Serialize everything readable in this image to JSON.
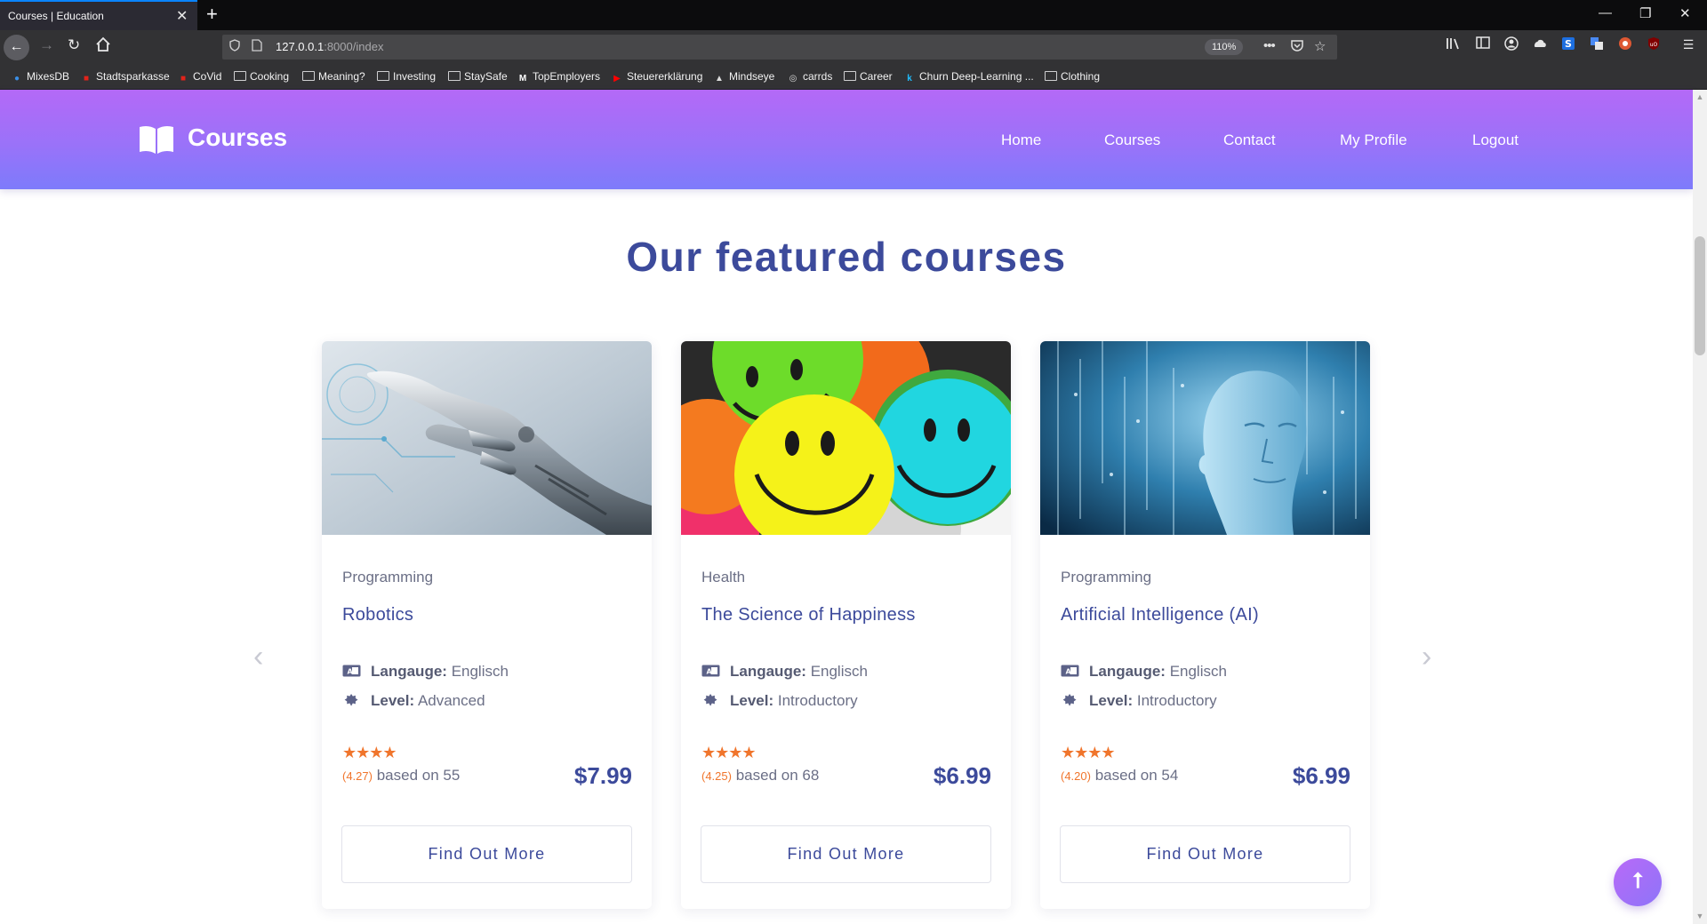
{
  "browser": {
    "tab_title": "Courses | Education",
    "tab_close": "✕",
    "new_tab": "+",
    "url_host": "127.0.0.1",
    "url_path": ":8000/index",
    "zoom": "110%",
    "window_controls": {
      "minimize": "—",
      "restore": "❐",
      "close": "✕"
    },
    "bookmarks": [
      {
        "label": "MixesDB",
        "icon": "mixesdb-icon",
        "color": "#3a8ee6"
      },
      {
        "label": "Stadtsparkasse",
        "icon": "sparkasse-icon",
        "color": "#e2231a"
      },
      {
        "label": "CoVid",
        "icon": "covid-icon",
        "color": "#e2231a"
      },
      {
        "label": "Cooking",
        "icon": "folder-icon"
      },
      {
        "label": "Meaning?",
        "icon": "folder-icon"
      },
      {
        "label": "Investing",
        "icon": "folder-icon"
      },
      {
        "label": "StaySafe",
        "icon": "folder-icon"
      },
      {
        "label": "TopEmployers",
        "icon": "medium-icon",
        "color": "#ffffff"
      },
      {
        "label": "Steuererklärung",
        "icon": "youtube-icon",
        "color": "#ff0000"
      },
      {
        "label": "Mindseye",
        "icon": "mindseye-icon",
        "color": "#dddddd"
      },
      {
        "label": "carrds",
        "icon": "globe-icon"
      },
      {
        "label": "Career",
        "icon": "folder-icon"
      },
      {
        "label": "Churn Deep-Learning ...",
        "icon": "kaggle-icon",
        "color": "#20beff"
      },
      {
        "label": "Clothing",
        "icon": "folder-icon"
      }
    ]
  },
  "site": {
    "logo_text": "Courses",
    "menu": [
      "Home",
      "Courses",
      "Contact",
      "My Profile",
      "Logout"
    ],
    "section_title": "Our featured courses",
    "language_label": "Langauge:",
    "level_label": "Level:",
    "based_on": "based on",
    "stars": "★★★★",
    "cta": "Find Out More",
    "prev_arrow": "‹",
    "next_arrow": "›",
    "to_top": "⭡",
    "accent": "#3c4a9b",
    "rating_color": "#f0752c"
  },
  "courses": [
    {
      "category": "Programming",
      "title": "Robotics",
      "language": "Englisch",
      "level": "Advanced",
      "rating": "(4.27)",
      "reviews": "55",
      "price": "$7.99",
      "image": "robotic-hand"
    },
    {
      "category": "Health",
      "title": "The Science of Happiness",
      "language": "Englisch",
      "level": "Introductory",
      "rating": "(4.25)",
      "reviews": "68",
      "price": "$6.99",
      "image": "smiley-faces"
    },
    {
      "category": "Programming",
      "title": "Artificial Intelligence (AI)",
      "language": "Englisch",
      "level": "Introductory",
      "rating": "(4.20)",
      "reviews": "54",
      "price": "$6.99",
      "image": "digital-head"
    }
  ]
}
